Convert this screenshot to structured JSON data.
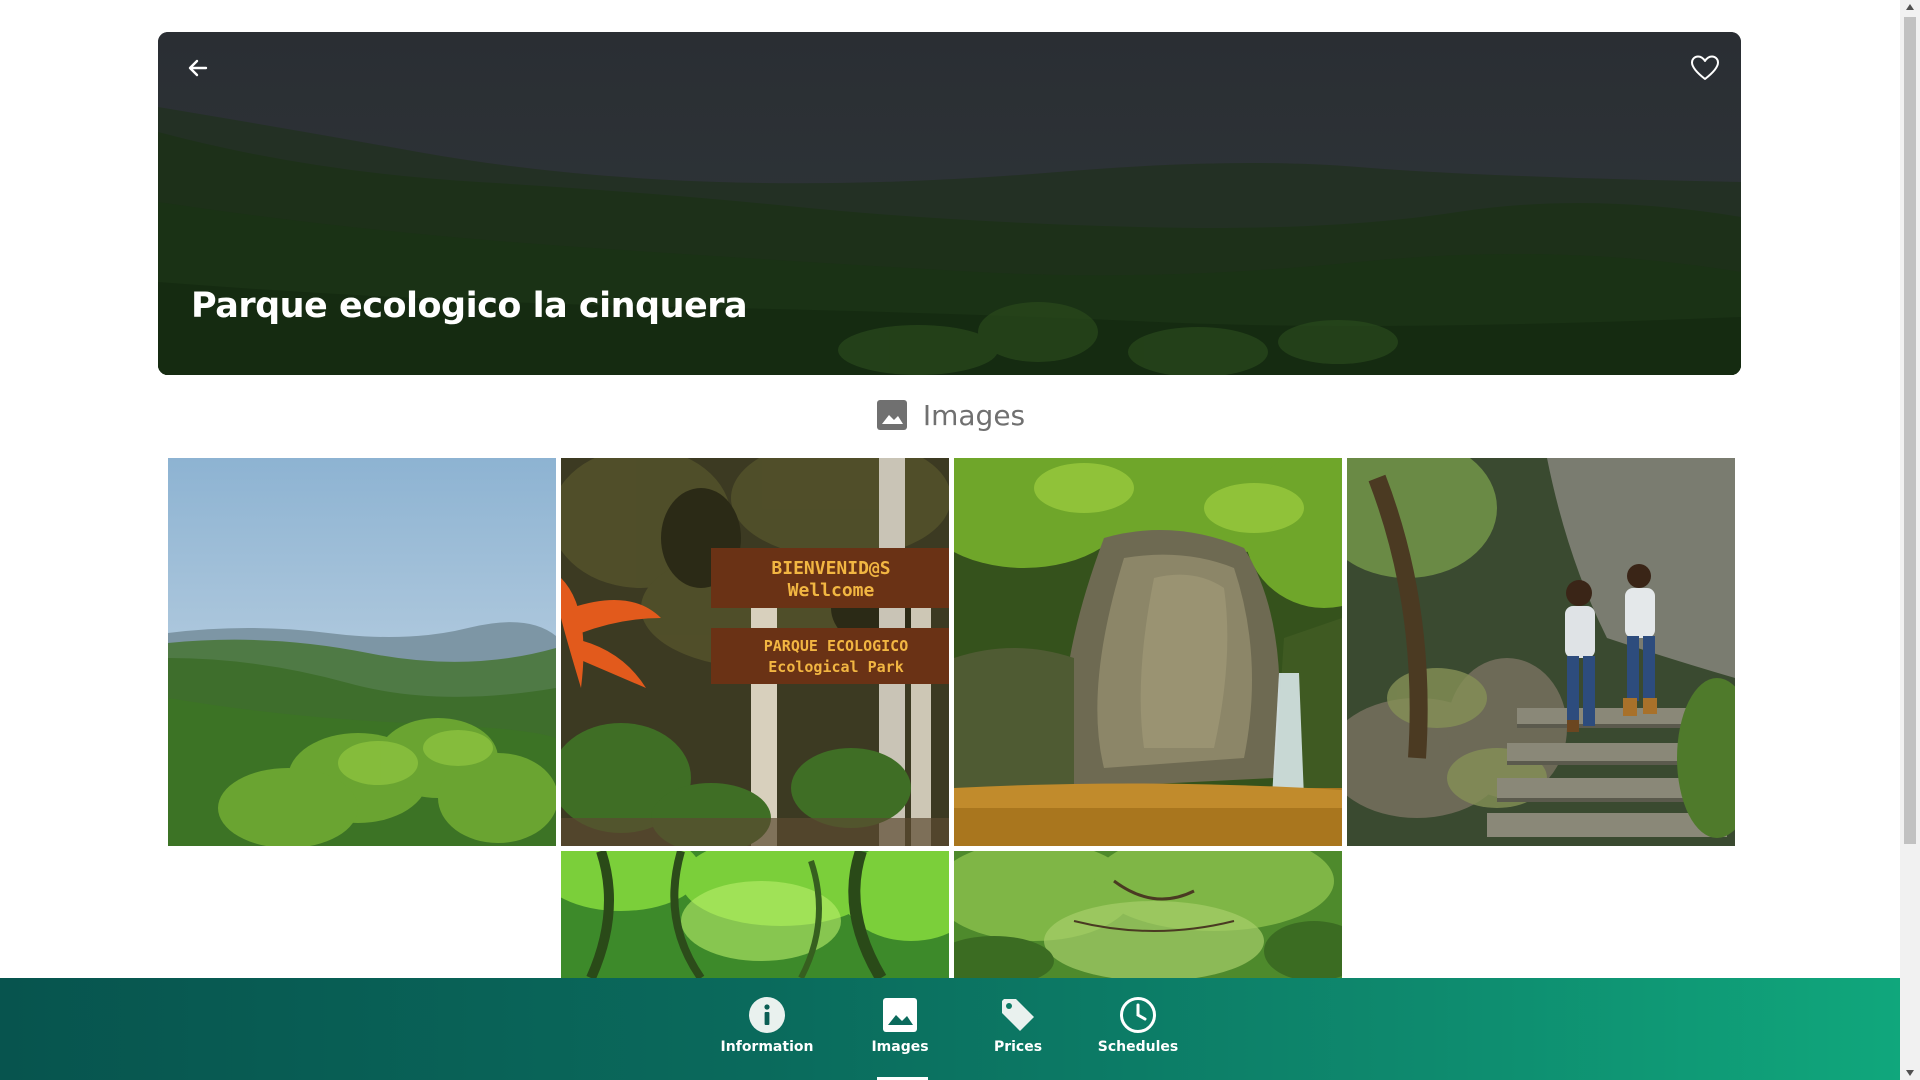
{
  "hero": {
    "title": "Parque ecologico la cinquera"
  },
  "icons": {
    "back": "arrow-left-icon",
    "favorite": "heart-outline-icon",
    "images": "image-icon",
    "information": "info-circle-icon",
    "prices": "tag-icon",
    "schedules": "clock-icon"
  },
  "section": {
    "title": "Images"
  },
  "gallery": {
    "images": [
      {
        "subject": "mountain-landscape"
      },
      {
        "subject": "welcome-sign",
        "sign_line1": "BIENVENID@S",
        "sign_line2": "Wellcome",
        "sign_line3": "PARQUE ECOLOGICO",
        "sign_line4": "Ecological Park"
      },
      {
        "subject": "waterfall"
      },
      {
        "subject": "hikers-on-stairs"
      },
      {
        "subject": "forest-canopy"
      },
      {
        "subject": "tree-canopy"
      }
    ]
  },
  "nav": {
    "active": "Images",
    "items": [
      {
        "label": "Information"
      },
      {
        "label": "Images"
      },
      {
        "label": "Prices"
      },
      {
        "label": "Schedules"
      }
    ]
  },
  "colors": {
    "nav_start": "#07544e",
    "nav_end": "#10a77c",
    "section_text": "#707070"
  }
}
